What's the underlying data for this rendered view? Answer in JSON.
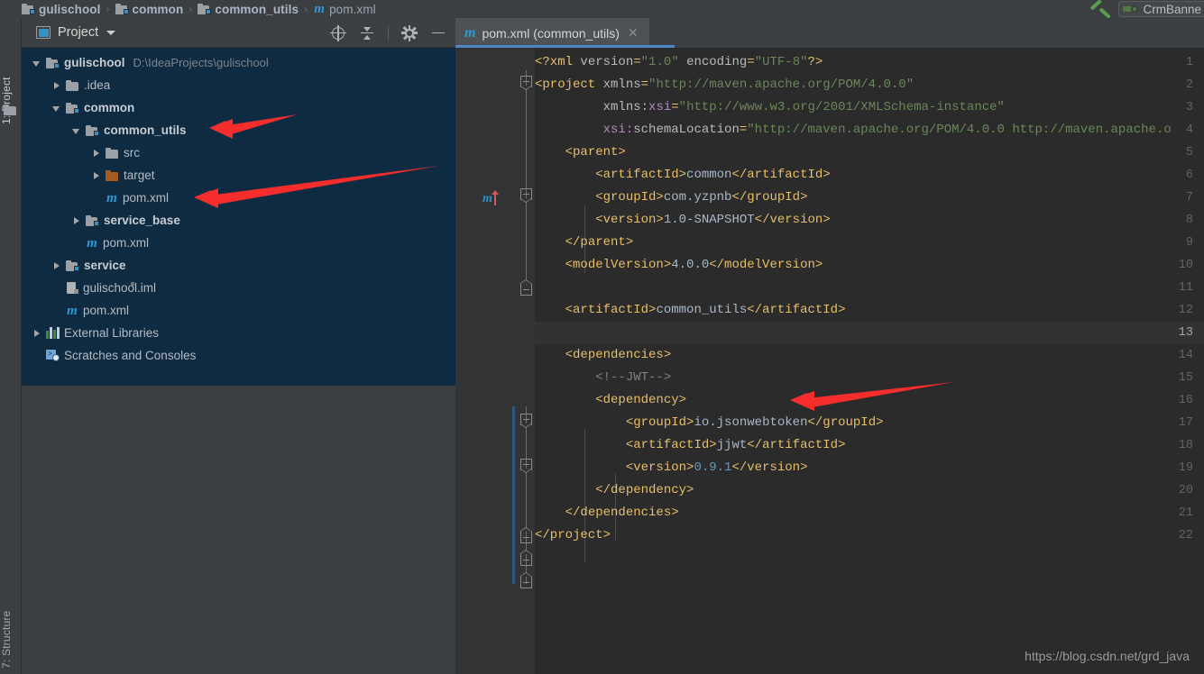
{
  "breadcrumb": {
    "items": [
      {
        "label": "gulischool",
        "icon": "module-icon",
        "type": "module"
      },
      {
        "label": "common",
        "icon": "module-icon",
        "type": "module"
      },
      {
        "label": "common_utils",
        "icon": "module-icon",
        "type": "module"
      },
      {
        "label": "pom.xml",
        "icon": "maven-file-icon",
        "type": "file"
      }
    ],
    "separator": "›"
  },
  "top_right": {
    "run_icon": "green-checkmark-icon",
    "chip_label": "CrmBanne",
    "chip_icon": "run-config-icon"
  },
  "left_strip": {
    "project_tab": "1: Project",
    "structure_tab": "7: Structure",
    "project_icon": "folder-icon"
  },
  "project_panel": {
    "title": "Project",
    "window_icon": "project-window-icon",
    "caret_icon": "chevron-down-icon",
    "tools": [
      {
        "name": "select-opened-file-icon",
        "label": "Select Opened File"
      },
      {
        "name": "collapse-all-icon",
        "label": "Collapse All"
      },
      {
        "name": "gear-icon",
        "label": "Settings"
      },
      {
        "name": "minimize-icon",
        "label": "Hide"
      }
    ]
  },
  "tree": [
    {
      "indent": 0,
      "twist": "down",
      "icon": "module-icon",
      "label": "gulischool",
      "bold": true,
      "path": "D:\\IdeaProjects\\gulischool"
    },
    {
      "indent": 1,
      "twist": "right",
      "icon": "folder-icon",
      "label": ".idea",
      "bold": false,
      "path": ""
    },
    {
      "indent": 1,
      "twist": "down",
      "icon": "module-icon",
      "label": "common",
      "bold": true,
      "path": ""
    },
    {
      "indent": 2,
      "twist": "down",
      "icon": "module-icon",
      "label": "common_utils",
      "bold": true,
      "path": ""
    },
    {
      "indent": 3,
      "twist": "right",
      "icon": "folder-icon",
      "label": "src",
      "bold": false,
      "path": ""
    },
    {
      "indent": 3,
      "twist": "right",
      "icon": "folder-orange-icon",
      "label": "target",
      "bold": false,
      "path": ""
    },
    {
      "indent": 3,
      "twist": "none",
      "icon": "maven-file-icon",
      "label": "pom.xml",
      "bold": false,
      "path": ""
    },
    {
      "indent": 2,
      "twist": "right",
      "icon": "module-icon",
      "label": "service_base",
      "bold": true,
      "path": ""
    },
    {
      "indent": 2,
      "twist": "none",
      "icon": "maven-file-icon",
      "label": "pom.xml",
      "bold": false,
      "path": ""
    },
    {
      "indent": 1,
      "twist": "right",
      "icon": "module-icon",
      "label": "service",
      "bold": true,
      "path": ""
    },
    {
      "indent": 1,
      "twist": "none",
      "icon": "iml-file-icon",
      "label": "gulischool.iml",
      "bold": false,
      "path": ""
    },
    {
      "indent": 1,
      "twist": "none",
      "icon": "maven-file-icon",
      "label": "pom.xml",
      "bold": false,
      "path": ""
    },
    {
      "indent": 0,
      "twist": "right",
      "icon": "libraries-icon",
      "label": "External Libraries",
      "bold": false,
      "path": ""
    },
    {
      "indent": 0,
      "twist": "none",
      "icon": "scratches-icon",
      "label": "Scratches and Consoles",
      "bold": false,
      "path": ""
    }
  ],
  "editor": {
    "tab": {
      "label": "pom.xml (common_utils)",
      "icon": "maven-file-icon",
      "close_icon": "close-icon"
    },
    "caret_line": 13,
    "gutter_marker": "maven-reimport-icon",
    "lines": [
      {
        "n": 1,
        "indent": 0,
        "html": "<span class='tag'>&lt;?xml</span> <span class='attr'>version</span><span class='tag'>=</span><span class='val'>\"1.0\"</span> <span class='attr'>encoding</span><span class='tag'>=</span><span class='val'>\"UTF-8\"</span><span class='tag'>?&gt;</span>"
      },
      {
        "n": 2,
        "indent": 0,
        "html": "<span class='tag'>&lt;project</span> <span class='attr'>xmlns</span><span class='tag'>=</span><span class='val'>\"http://maven.apache.org/POM/4.0.0\"</span>"
      },
      {
        "n": 3,
        "indent": 0,
        "html": "         <span class='attr'>xmlns:</span><span class='ns'>xsi</span><span class='tag'>=</span><span class='val'>\"http://www.w3.org/2001/XMLSchema-instance\"</span>"
      },
      {
        "n": 4,
        "indent": 0,
        "html": "         <span class='ns'>xsi:</span><span class='attr'>schemaLocation</span><span class='tag'>=</span><span class='val'>\"http://maven.apache.org/POM/4.0.0 http://maven.apache.o</span>"
      },
      {
        "n": 5,
        "indent": 0,
        "html": "    <span class='tag'>&lt;parent&gt;</span>"
      },
      {
        "n": 6,
        "indent": 0,
        "html": "        <span class='tag'>&lt;artifactId&gt;</span><span class='txt'>common</span><span class='tag'>&lt;/artifactId&gt;</span>"
      },
      {
        "n": 7,
        "indent": 0,
        "html": "        <span class='tag'>&lt;groupId&gt;</span><span class='txt'>com.yzpnb</span><span class='tag'>&lt;/groupId&gt;</span>"
      },
      {
        "n": 8,
        "indent": 0,
        "html": "        <span class='tag'>&lt;version&gt;</span><span class='txt'>1.0-SNAPSHOT</span><span class='tag'>&lt;/version&gt;</span>"
      },
      {
        "n": 9,
        "indent": 0,
        "html": "    <span class='tag'>&lt;/parent&gt;</span>"
      },
      {
        "n": 10,
        "indent": 0,
        "html": "    <span class='tag'>&lt;modelVersion&gt;</span><span class='txt'>4.0.0</span><span class='tag'>&lt;/modelVersion&gt;</span>"
      },
      {
        "n": 11,
        "indent": 0,
        "html": ""
      },
      {
        "n": 12,
        "indent": 0,
        "html": "    <span class='tag'>&lt;artifactId&gt;</span><span class='txt'>common_utils</span><span class='tag'>&lt;/artifactId&gt;</span>"
      },
      {
        "n": 13,
        "indent": 0,
        "html": ""
      },
      {
        "n": 14,
        "indent": 0,
        "html": "    <span class='tag'>&lt;dependencies&gt;</span>"
      },
      {
        "n": 15,
        "indent": 0,
        "html": "        <span class='cmt'>&lt;!--JWT--&gt;</span>"
      },
      {
        "n": 16,
        "indent": 0,
        "html": "        <span class='tag'>&lt;dependency&gt;</span>"
      },
      {
        "n": 17,
        "indent": 0,
        "html": "            <span class='tag'>&lt;groupId&gt;</span><span class='txt'>io.jsonwebtoken</span><span class='tag'>&lt;/groupId&gt;</span>"
      },
      {
        "n": 18,
        "indent": 0,
        "html": "            <span class='tag'>&lt;artifactId&gt;</span><span class='txt'>jjwt</span><span class='tag'>&lt;/artifactId&gt;</span>"
      },
      {
        "n": 19,
        "indent": 0,
        "html": "            <span class='tag'>&lt;version&gt;</span><span class='num'>0.9.1</span><span class='tag'>&lt;/version&gt;</span>"
      },
      {
        "n": 20,
        "indent": 0,
        "html": "        <span class='tag'>&lt;/dependency&gt;</span>"
      },
      {
        "n": 21,
        "indent": 0,
        "html": "    <span class='tag'>&lt;/dependencies&gt;</span>"
      },
      {
        "n": 22,
        "indent": 0,
        "html": "<span class='tag'>&lt;/project&gt;</span>"
      }
    ]
  },
  "watermark": "https://blog.csdn.net/grd_java",
  "annotations": [
    {
      "name": "arrow-to-common-utils",
      "color": "#f52d2d"
    },
    {
      "name": "arrow-to-pom-xml",
      "color": "#f52d2d"
    },
    {
      "name": "arrow-to-dependency-tag",
      "color": "#f52d2d"
    }
  ],
  "colors": {
    "panel_bg": "#3c3f41",
    "tree_bg": "#0e2b42",
    "editor_bg": "#2b2b2b",
    "gutter_bg": "#313335",
    "accent": "#4a88c7",
    "annotation_red": "#f52d2d"
  }
}
